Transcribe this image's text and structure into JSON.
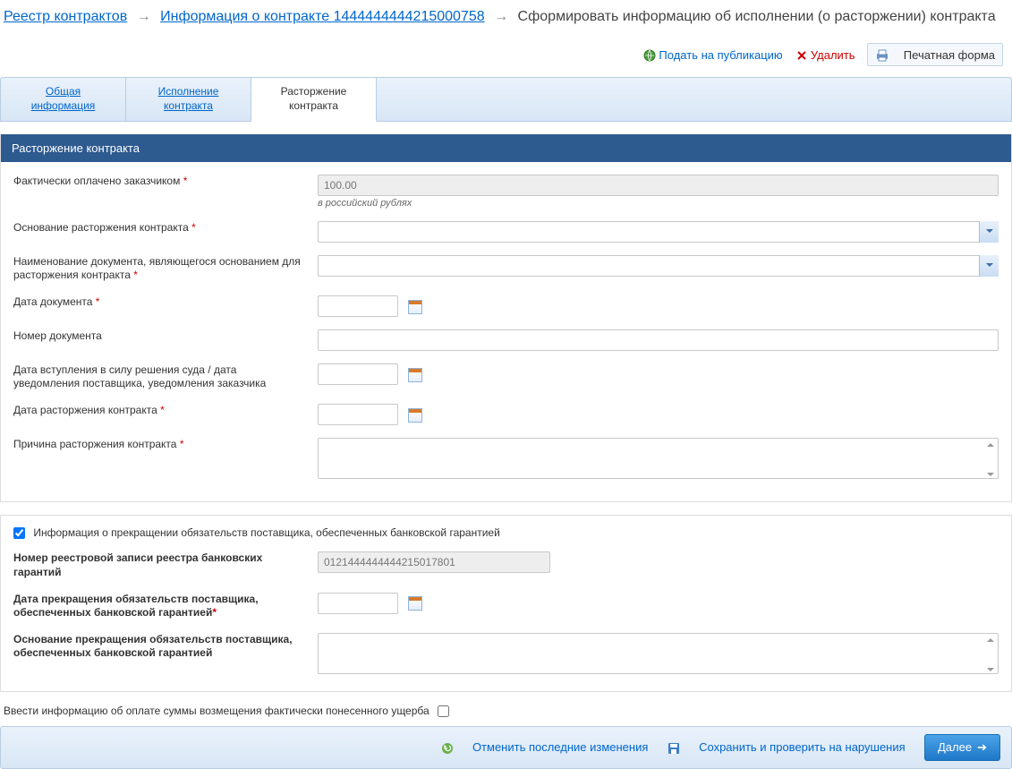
{
  "breadcrumb": {
    "registry": "Реестр контрактов",
    "contract_info": "Информация о контракте 1444444444215000758",
    "current": "Сформировать информацию об исполнении (о расторжении) контракта"
  },
  "toolbar": {
    "publish": "Подать на публикацию",
    "delete": "Удалить",
    "print": "Печатная форма"
  },
  "tabs": {
    "general": "Общая\nинформация",
    "execution": "Исполнение\nконтракта",
    "termination": "Расторжение\nконтракта"
  },
  "panel_title": "Расторжение контракта",
  "fields": {
    "paid_label": "Фактически оплачено заказчиком",
    "paid_value": "100.00",
    "paid_hint": "в российский рублях",
    "basis_label": "Основание расторжения контракта",
    "doc_name_label": "Наименование документа, являющегося основанием для расторжения контракта",
    "doc_date_label": "Дата документа",
    "doc_num_label": "Номер документа",
    "court_date_label": "Дата вступления в силу решения суда / дата уведомления поставщика, уведомления заказчика",
    "term_date_label": "Дата расторжения контракта",
    "reason_label": "Причина расторжения контракта"
  },
  "bank": {
    "checkbox_label": "Информация о прекращении обязательств поставщика, обеспеченных банковской гарантией",
    "reg_num_label": "Номер реестровой записи реестра банковских гарантий",
    "reg_num_value": "0121444444444215017801",
    "stop_date_label": "Дата прекращения обязательств поставщика, обеспеченных банковской гарантией",
    "stop_basis_label": "Основание прекращения обязательств поставщика, обеспеченных банковской гарантией"
  },
  "damage_label": "Ввести информацию об оплате суммы возмещения фактически понесенного ущерба",
  "footer": {
    "undo": "Отменить последние изменения",
    "save": "Сохранить и проверить на нарушения",
    "next": "Далее"
  }
}
